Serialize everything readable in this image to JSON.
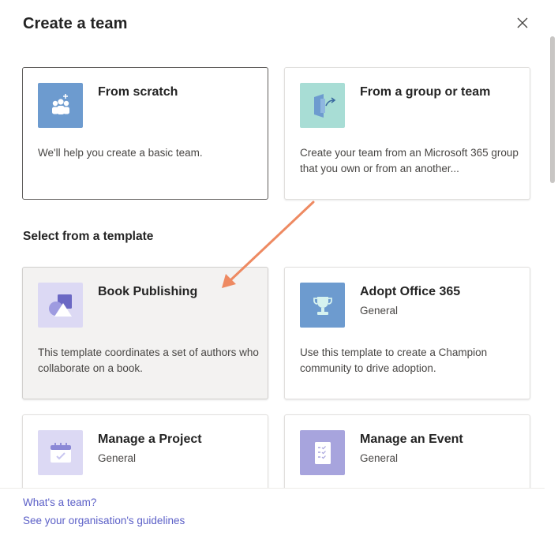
{
  "dialog": {
    "title": "Create a team",
    "close_icon": "close-icon"
  },
  "create_options": [
    {
      "title": "From scratch",
      "description": "We'll help you create a basic team.",
      "icon": "people-add-icon",
      "tile_color": "#6d9bcf",
      "state": "selected"
    },
    {
      "title": "From a group or team",
      "description": "Create your team from an Microsoft 365 group that you own or from an another...",
      "icon": "group-arrow-icon",
      "tile_color": "#a8ddd5"
    }
  ],
  "section_heading": "Select from a template",
  "templates": [
    {
      "title": "Book Publishing",
      "subtitle": "",
      "description": "This template coordinates a set of authors who collaborate on a book.",
      "icon": "shapes-icon",
      "tile_color": "#dcd9f4",
      "state": "hover"
    },
    {
      "title": "Adopt Office 365",
      "subtitle": "General",
      "description": "Use this template to create a Champion community to drive adoption.",
      "icon": "trophy-icon",
      "tile_color": "#6d9bcf"
    },
    {
      "title": "Manage a Project",
      "subtitle": "General",
      "description": "",
      "icon": "calendar-check-icon",
      "tile_color": "#dcd9f4"
    },
    {
      "title": "Manage an Event",
      "subtitle": "General",
      "description": "",
      "icon": "checklist-icon",
      "tile_color": "#a7a4dd"
    }
  ],
  "footer": {
    "link1": "What's a team?",
    "link2": "See your organisation's guidelines"
  },
  "annotation": {
    "arrow_color": "#ee8a62"
  }
}
